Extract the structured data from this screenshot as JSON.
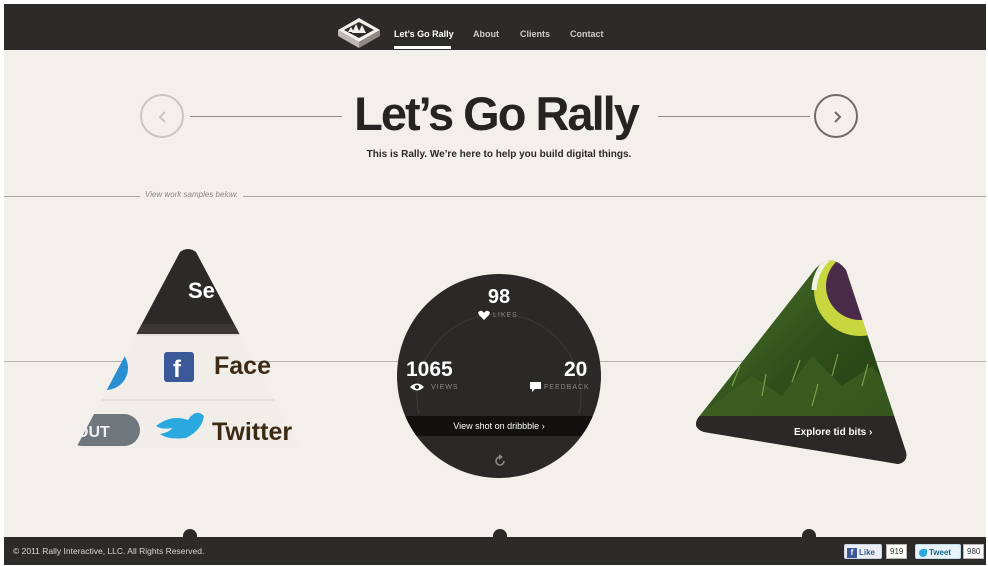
{
  "nav": {
    "items": [
      {
        "label": "Let’s Go Rally",
        "active": true
      },
      {
        "label": "About"
      },
      {
        "label": "Clients"
      },
      {
        "label": "Contact"
      }
    ]
  },
  "hero": {
    "title": "Let’s Go Rally",
    "subtitle": "This is Rally. We’re here to help you build digital things.",
    "prev_icon": "chevron-left-icon",
    "next_icon": "chevron-right-icon"
  },
  "section_label": "View work samples below.",
  "share_panel": {
    "top_text": "Se",
    "facebook_text": "Face",
    "out_text": "OUT",
    "twitter_text": "Twitter"
  },
  "dribbble_stats": {
    "likes": "98",
    "likes_label": "LIKES",
    "views": "1065",
    "views_label": "VIEWS",
    "feedback": "20",
    "feedback_label": "FEEDBACK",
    "link_label": "View shot on dribbble ›"
  },
  "tid_bits": {
    "link_label": "Explore tid bits ›"
  },
  "footer": {
    "copyright": "© 2011 Rally Interactive, LLC. All Rights Reserved.",
    "like_label": "Like",
    "like_count": "919",
    "tweet_label": "Tweet",
    "tweet_count": "980"
  },
  "colors": {
    "dark": "#2d2b29",
    "background": "#f3efeb",
    "facebook_blue": "#3b5998",
    "twitter_blue": "#2aa9e0"
  }
}
